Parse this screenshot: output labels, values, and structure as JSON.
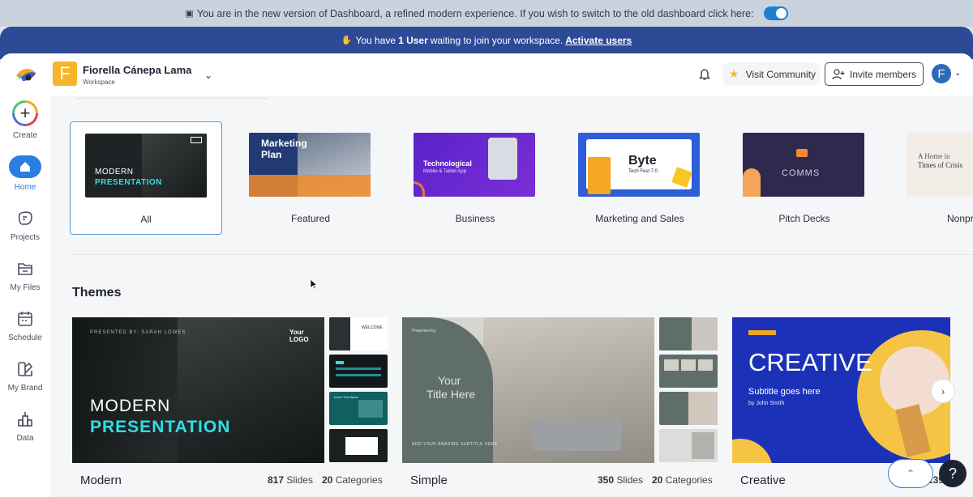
{
  "banner": {
    "text": "You are in the new version of Dashboard, a refined modern experience. If you wish to switch to the old dashboard click here:",
    "toggle_on": true
  },
  "user_banner": {
    "prefix": "You have",
    "count_text": "1 User",
    "suffix": "waiting to join your workspace.",
    "link": "Activate users"
  },
  "sidebar": {
    "items": [
      {
        "label": "Create",
        "icon": "plus-icon"
      },
      {
        "label": "Home",
        "icon": "home-icon",
        "active": true
      },
      {
        "label": "Projects",
        "icon": "projects-icon"
      },
      {
        "label": "My Files",
        "icon": "folder-icon"
      },
      {
        "label": "Schedule",
        "icon": "calendar-icon"
      },
      {
        "label": "My Brand",
        "icon": "brand-icon"
      },
      {
        "label": "Data",
        "icon": "data-icon"
      }
    ]
  },
  "header": {
    "workspace_initial": "F",
    "workspace_name": "Fiorella Cánepa Lama",
    "workspace_sub": "Workspace",
    "visit_community": "Visit Community",
    "invite_members": "Invite members",
    "avatar_initial": "F"
  },
  "categories": [
    {
      "label": "All",
      "thumb_title": "MODERN",
      "thumb_sub": "PRESENTATION"
    },
    {
      "label": "Featured",
      "thumb_title": "Marketing",
      "thumb_sub": "Plan"
    },
    {
      "label": "Business",
      "thumb_title": "Technological",
      "thumb_sub": "Mobile & Tablet App"
    },
    {
      "label": "Marketing and Sales",
      "thumb_title": "Byte",
      "thumb_sub": "Tech Fest 7.0"
    },
    {
      "label": "Pitch Decks",
      "thumb_title": "COMMS",
      "thumb_sub": ""
    },
    {
      "label": "Nonpr",
      "thumb_title": "A Home in",
      "thumb_sub": "Times of Crisis"
    }
  ],
  "themes_title": "Themes",
  "themes": [
    {
      "name": "Modern",
      "slides": "817",
      "slides_label": "Slides",
      "categories": "20",
      "categories_label": "Categories",
      "line1": "MODERN",
      "line2": "PRESENTATION",
      "presented": "PRESENTED BY: SARAH LOWES",
      "logo": "Your LOGO",
      "welcome": "WELCOME",
      "small": "Insert The Name"
    },
    {
      "name": "Simple",
      "slides": "350",
      "slides_label": "Slides",
      "categories": "20",
      "categories_label": "Categories",
      "line1": "Your",
      "line2": "Title Here",
      "presented": "Presented by",
      "sub": "ADD YOUR AMAZING SUBTITLE HERE"
    },
    {
      "name": "Creative",
      "slides": "139",
      "line1": "CREATIVE",
      "sub": "Subtitle goes here",
      "author": "by John Smith"
    }
  ],
  "colors": {
    "accent": "#2a7de1",
    "banner_bg": "#c9d3de",
    "user_banner_bg": "#2d4a97",
    "modern_cyan": "#2ee0e6",
    "creative_blue": "#1b32b8",
    "workspace_yellow": "#f7b52c"
  }
}
